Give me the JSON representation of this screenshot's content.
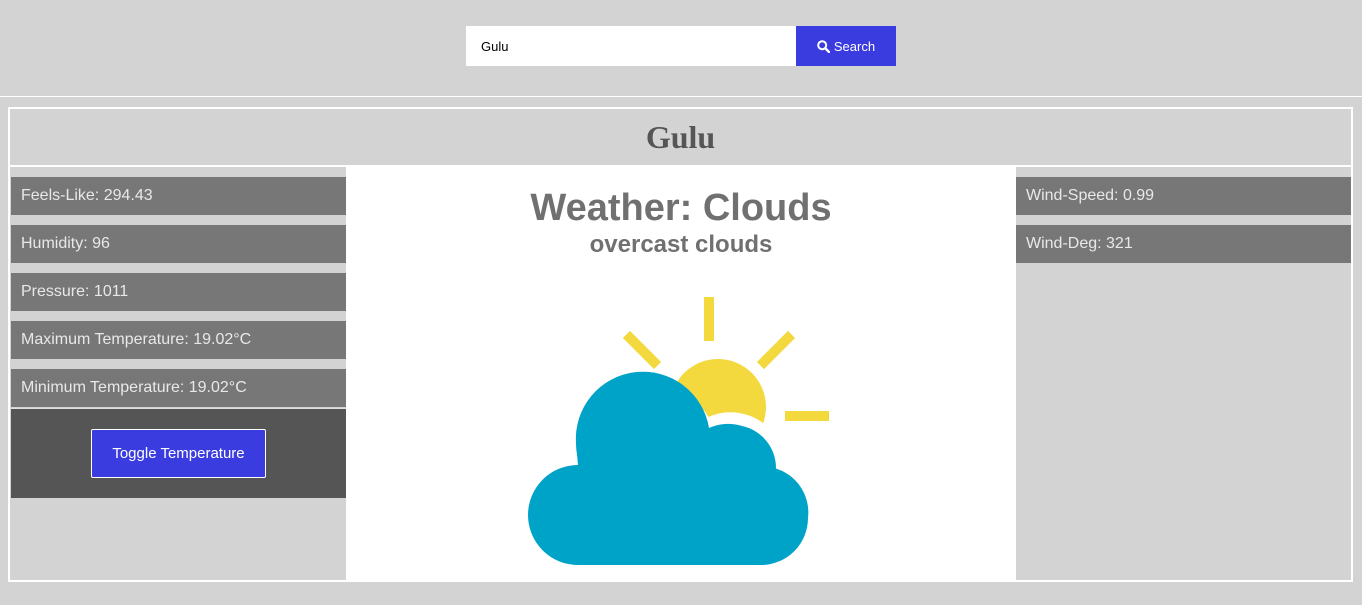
{
  "search": {
    "value": "Gulu",
    "button_label": "Search"
  },
  "city": {
    "name": "Gulu"
  },
  "left_stats": [
    {
      "label": "Feels-Like: 294.43"
    },
    {
      "label": "Humidity: 96"
    },
    {
      "label": "Pressure: 1011"
    },
    {
      "label": "Maximum Temperature: 19.02°C"
    },
    {
      "label": "Minimum Temperature: 19.02°C"
    }
  ],
  "toggle_label": "Toggle Temperature",
  "weather": {
    "main": "Weather: Clouds",
    "description": "overcast clouds",
    "icon": "sun-behind-cloud-icon"
  },
  "right_stats": [
    {
      "label": "Wind-Speed: 0.99"
    },
    {
      "label": "Wind-Deg: 321"
    }
  ],
  "colors": {
    "accent": "#3a3ce0",
    "background": "#d3d3d3",
    "stat_bg": "#777777",
    "cloud": "#00a3c8",
    "sun": "#f4d93e"
  }
}
